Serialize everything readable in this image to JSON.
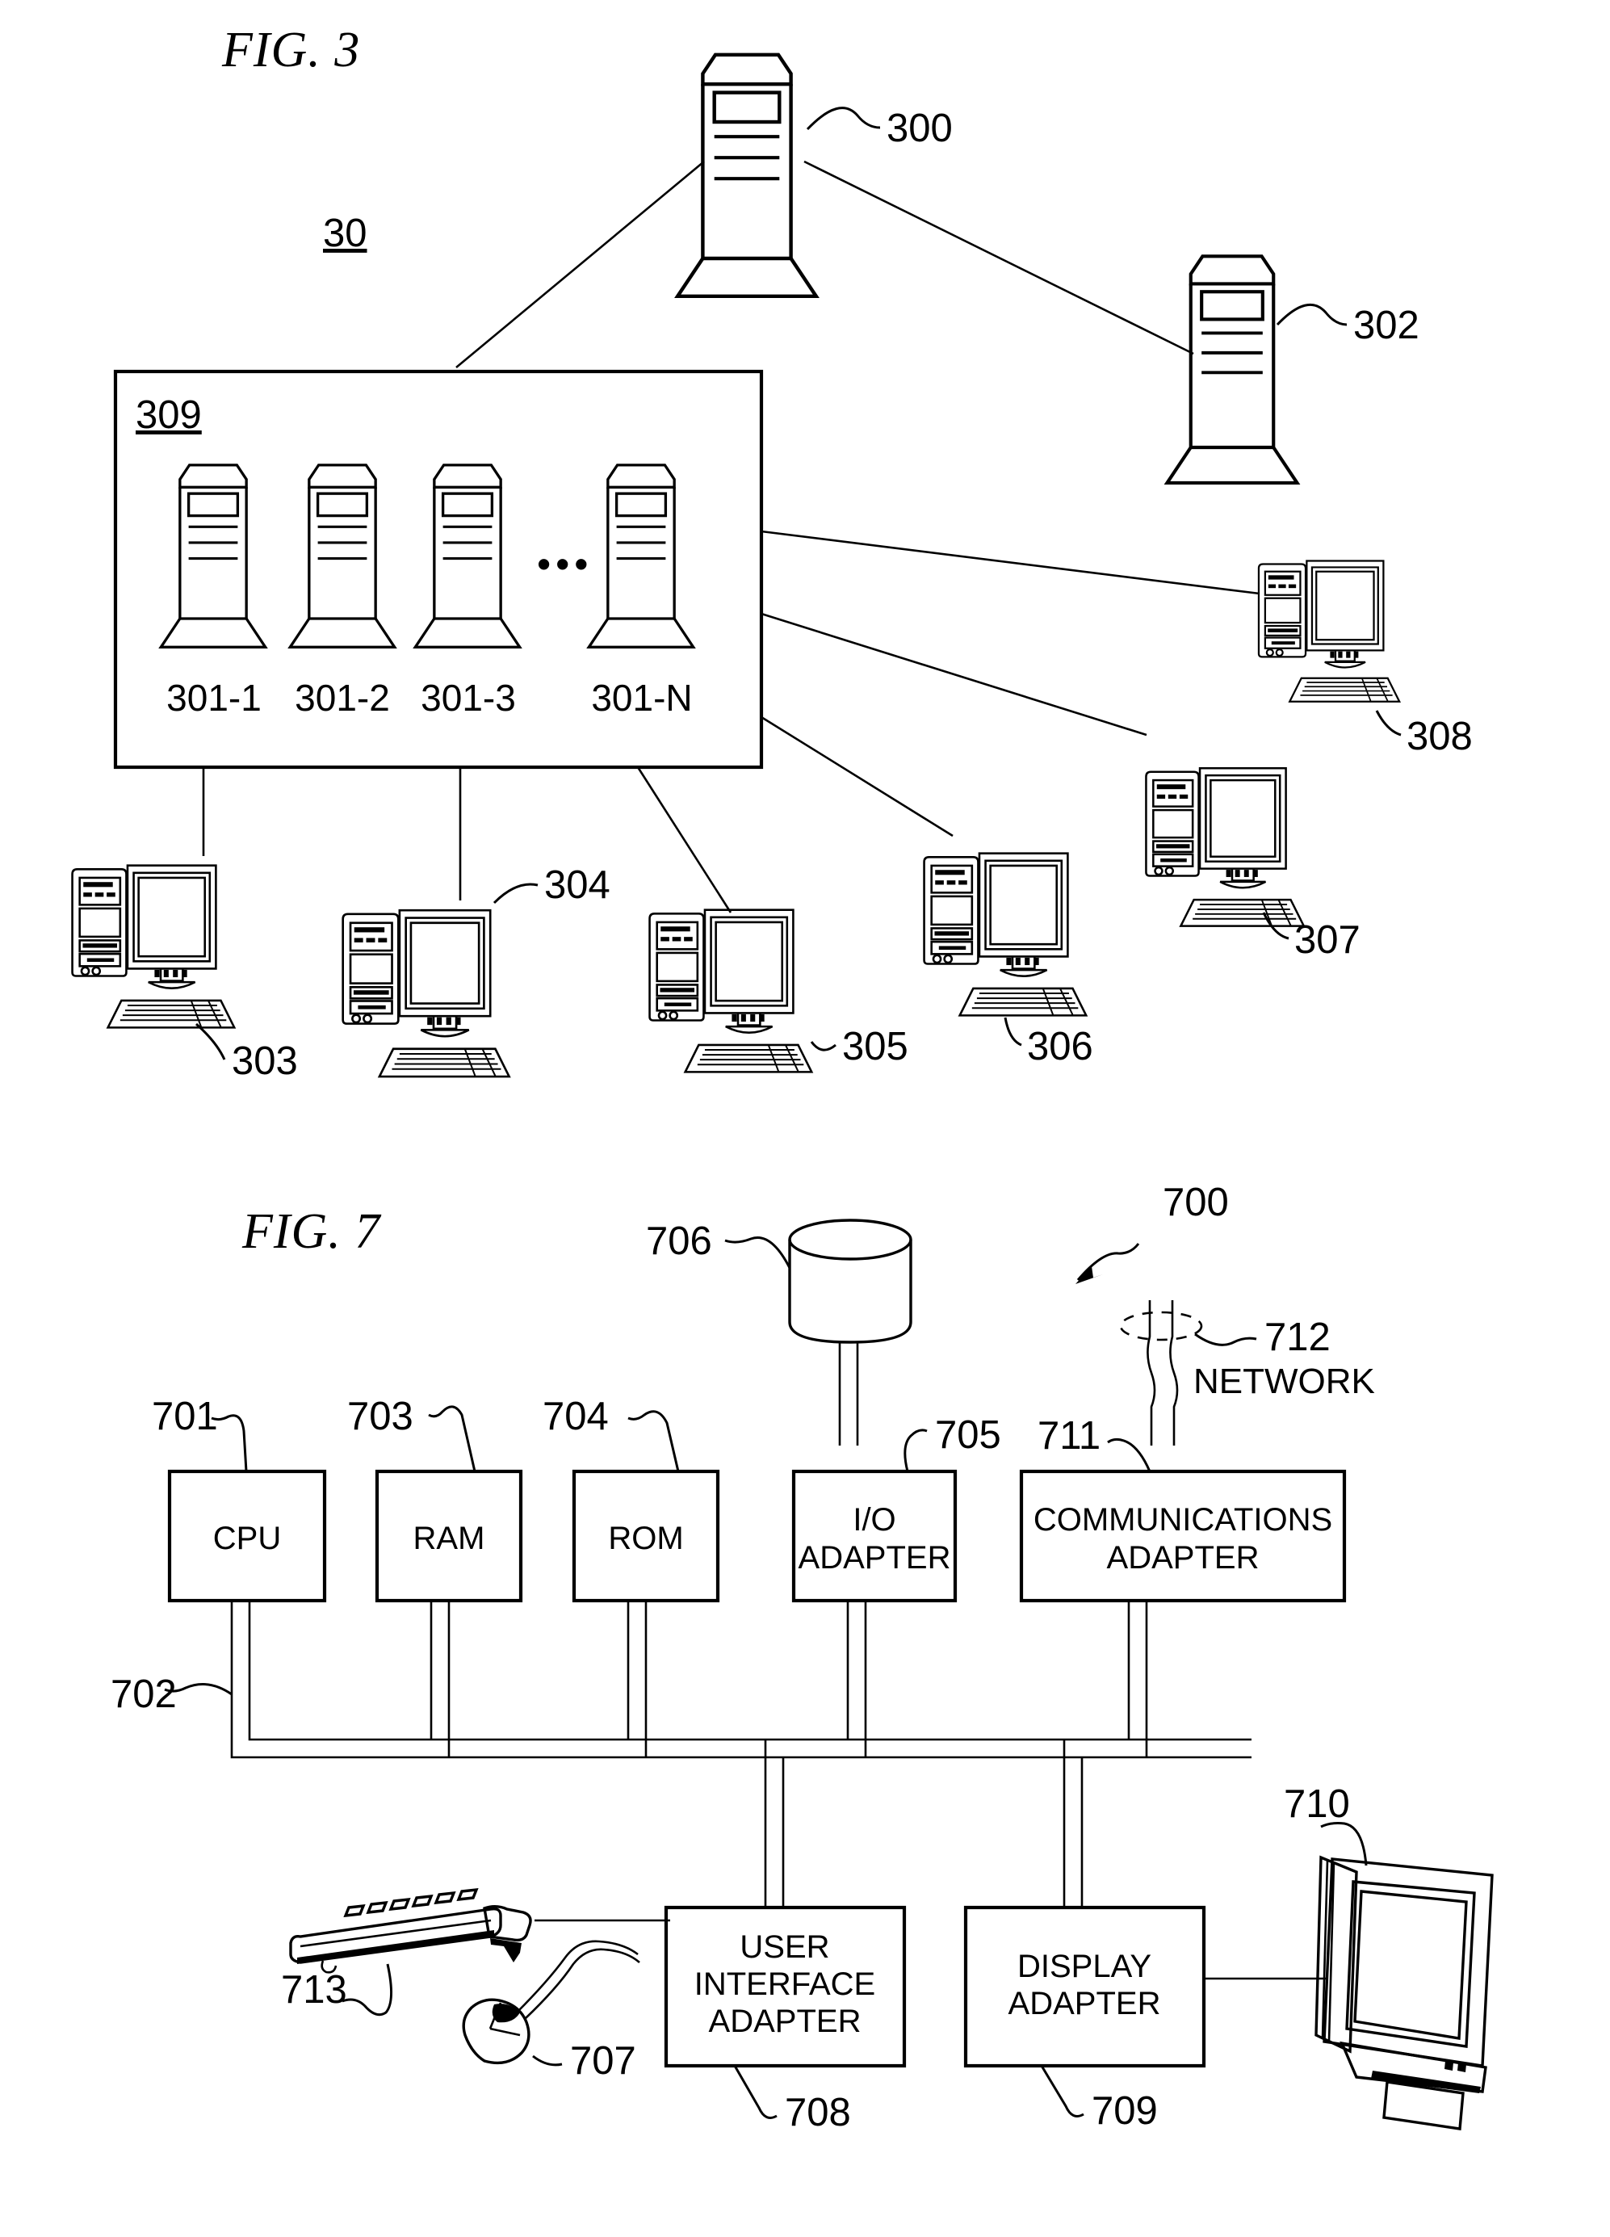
{
  "figures": [
    {
      "id": "fig3",
      "title": "FIG. 3",
      "system_label": "30",
      "cluster_label": "309",
      "ellipsis": "•••",
      "servers": [
        {
          "ref": "300",
          "kind": "tower-server"
        },
        {
          "ref": "302",
          "kind": "tower-server"
        }
      ],
      "cluster_servers": [
        {
          "ref": "301-1",
          "kind": "tower-server"
        },
        {
          "ref": "301-2",
          "kind": "tower-server"
        },
        {
          "ref": "301-3",
          "kind": "tower-server"
        },
        {
          "ref": "301-N",
          "kind": "tower-server"
        }
      ],
      "clients": [
        {
          "ref": "303",
          "kind": "desktop-computer"
        },
        {
          "ref": "304",
          "kind": "desktop-computer"
        },
        {
          "ref": "305",
          "kind": "desktop-computer"
        },
        {
          "ref": "306",
          "kind": "desktop-computer"
        },
        {
          "ref": "307",
          "kind": "desktop-computer"
        },
        {
          "ref": "308",
          "kind": "desktop-computer"
        }
      ]
    },
    {
      "id": "fig7",
      "title": "FIG. 7",
      "system_ref": "700",
      "bus_ref": "702",
      "network_ref": "712",
      "network_label": "NETWORK",
      "blocks": [
        {
          "ref": "701",
          "label": "CPU",
          "lines": [
            "CPU"
          ]
        },
        {
          "ref": "703",
          "label": "RAM",
          "lines": [
            "RAM"
          ]
        },
        {
          "ref": "704",
          "label": "ROM",
          "lines": [
            "ROM"
          ]
        },
        {
          "ref": "705",
          "label": "I/O ADAPTER",
          "lines": [
            "I/O",
            "ADAPTER"
          ]
        },
        {
          "ref": "711",
          "label": "COMMUNICATIONS ADAPTER",
          "lines": [
            "COMMUNICATIONS",
            "ADAPTER"
          ]
        },
        {
          "ref": "708",
          "label": "USER INTERFACE ADAPTER",
          "lines": [
            "USER",
            "INTERFACE",
            "ADAPTER"
          ]
        },
        {
          "ref": "709",
          "label": "DISPLAY ADAPTER",
          "lines": [
            "DISPLAY",
            "ADAPTER"
          ]
        }
      ],
      "peripherals": [
        {
          "ref": "706",
          "kind": "disk-storage-cylinder"
        },
        {
          "ref": "707",
          "kind": "mouse"
        },
        {
          "ref": "710",
          "kind": "flat-panel-display"
        },
        {
          "ref": "713",
          "kind": "keyboard"
        }
      ]
    }
  ],
  "text": {
    "fig3_title": "FIG. 3",
    "fig7_title": "FIG. 7",
    "label_30": "30",
    "label_309": "309",
    "label_300": "300",
    "label_302": "302",
    "label_301_1": "301-1",
    "label_301_2": "301-2",
    "label_301_3": "301-3",
    "label_301_N": "301-N",
    "label_303": "303",
    "label_304": "304",
    "label_305": "305",
    "label_306": "306",
    "label_307": "307",
    "label_308": "308",
    "label_ellipsis": "•••",
    "label_700": "700",
    "label_701": "701",
    "label_702": "702",
    "label_703": "703",
    "label_704": "704",
    "label_705": "705",
    "label_706": "706",
    "label_707": "707",
    "label_708": "708",
    "label_709": "709",
    "label_710": "710",
    "label_711": "711",
    "label_712": "712",
    "label_713": "713",
    "label_network": "NETWORK",
    "cpu": "CPU",
    "ram": "RAM",
    "rom": "ROM",
    "io_l1": "I/O",
    "io_l2": "ADAPTER",
    "comm_l1": "COMMUNICATIONS",
    "comm_l2": "ADAPTER",
    "uia_l1": "USER",
    "uia_l2": "INTERFACE",
    "uia_l3": "ADAPTER",
    "disp_l1": "DISPLAY",
    "disp_l2": "ADAPTER"
  },
  "colors": {
    "ink": "#000000",
    "paper": "#ffffff"
  }
}
